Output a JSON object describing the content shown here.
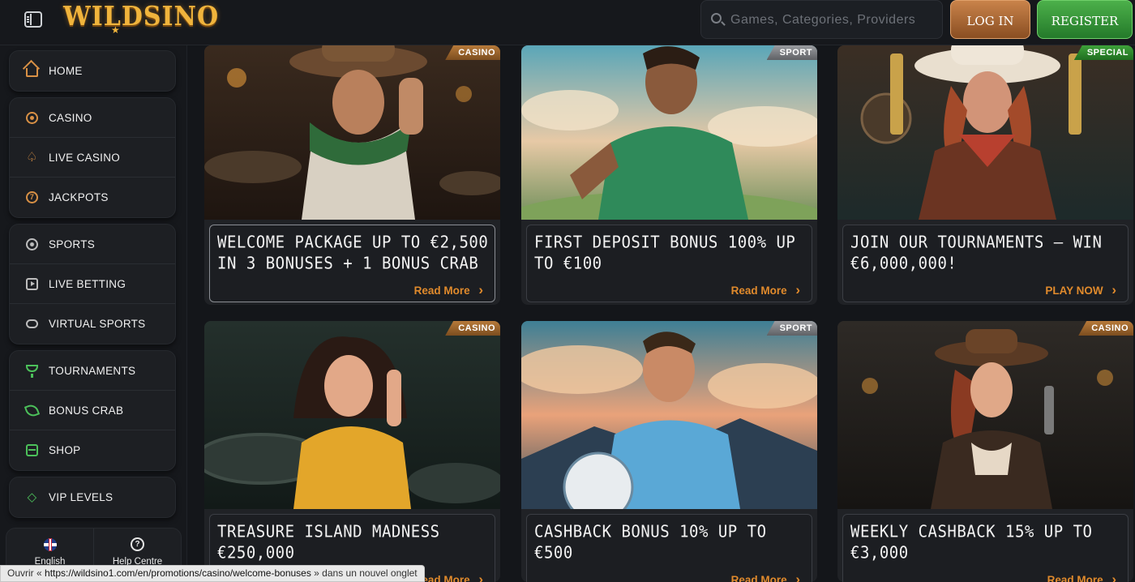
{
  "header": {
    "logo_text": "WILDSINO",
    "search_placeholder": "Games, Categories, Providers",
    "login_label": "LOG IN",
    "register_label": "REGISTER"
  },
  "sidebar": {
    "groups": [
      {
        "items": [
          {
            "label": "HOME",
            "icon": "home-icon"
          }
        ]
      },
      {
        "items": [
          {
            "label": "CASINO",
            "icon": "casino-chip-icon"
          },
          {
            "label": "LIVE CASINO",
            "icon": "spade-icon"
          },
          {
            "label": "JACKPOTS",
            "icon": "jackpot-icon"
          }
        ]
      },
      {
        "items": [
          {
            "label": "SPORTS",
            "icon": "soccer-ball-icon"
          },
          {
            "label": "LIVE BETTING",
            "icon": "live-play-icon"
          },
          {
            "label": "VIRTUAL SPORTS",
            "icon": "gamepad-icon"
          }
        ]
      },
      {
        "items": [
          {
            "label": "TOURNAMENTS",
            "icon": "trophy-icon"
          },
          {
            "label": "BONUS CRAB",
            "icon": "crab-icon"
          },
          {
            "label": "SHOP",
            "icon": "shop-icon"
          }
        ]
      },
      {
        "items": [
          {
            "label": "VIP LEVELS",
            "icon": "diamond-icon"
          }
        ]
      }
    ],
    "language_label": "English",
    "help_label": "Help Centre"
  },
  "promotions": [
    {
      "tag": "CASINO",
      "title": "WELCOME PACKAGE UP TO €2,500 IN 3 BONUSES + 1 BONUS CRAB",
      "cta": "Read More",
      "image": "cowboy-with-green-scarf-in-saloon"
    },
    {
      "tag": "SPORT",
      "title": "FIRST DEPOSIT BONUS 100% UP TO €100",
      "cta": "Read More",
      "image": "footballer-in-green-jersey"
    },
    {
      "tag": "SPECIAL",
      "title": "JOIN OUR TOURNAMENTS – WIN €6,000,000!",
      "cta": "PLAY NOW",
      "image": "cowgirl-with-golden-revolvers"
    },
    {
      "tag": "CASINO",
      "title": "TREASURE ISLAND MADNESS €250,000",
      "cta": "Read More",
      "image": "woman-in-yellow-dress-at-roulette"
    },
    {
      "tag": "SPORT",
      "title": "CASHBACK BONUS 10% UP TO €500",
      "cta": "Read More",
      "image": "footballer-in-blue-with-ball"
    },
    {
      "tag": "CASINO",
      "title": "WEEKLY CASHBACK 15% UP TO €3,000",
      "cta": "Read More",
      "image": "cowgirl-with-pistol-in-saloon"
    }
  ],
  "statusbar": {
    "prefix": "Ouvrir « ",
    "url": "https://wildsino1.com/en/promotions/casino/welcome-bonuses",
    "suffix": " » dans un nouvel onglet"
  },
  "colors": {
    "accent_orange": "#e08a2c",
    "login_bronze": "#b06a33",
    "register_green": "#3f9c3c"
  }
}
